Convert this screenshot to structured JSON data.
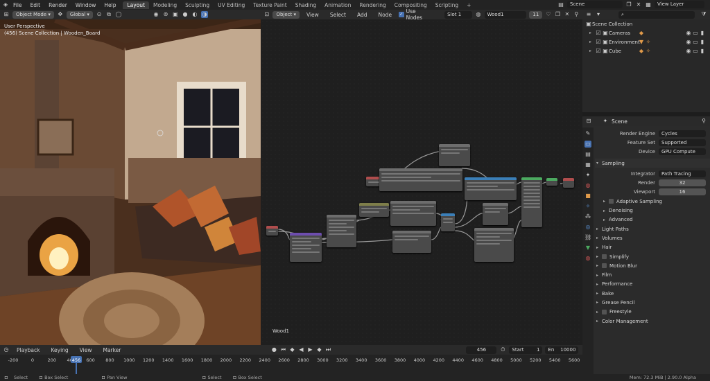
{
  "topbar": {
    "menu": [
      "File",
      "Edit",
      "Render",
      "Window",
      "Help"
    ],
    "tabs": [
      "Layout",
      "Modeling",
      "Sculpting",
      "UV Editing",
      "Texture Paint",
      "Shading",
      "Animation",
      "Rendering",
      "Compositing",
      "Scripting"
    ],
    "active_tab": "Layout",
    "scene": "Scene",
    "view_layer": "View Layer"
  },
  "viewport_header": {
    "mode": "Object Mode",
    "orientation": "Global"
  },
  "viewport": {
    "perspective": "User Perspective",
    "collection": "(456) Scene Collection | Wooden_Board"
  },
  "node_header": {
    "object": "Object",
    "menu": [
      "View",
      "Select",
      "Add",
      "Node"
    ],
    "use_nodes": "Use Nodes",
    "slot": "Slot 1",
    "material": "Wood1",
    "users": "11"
  },
  "node_editor": {
    "material_label": "Wood1"
  },
  "outliner": {
    "root": "Scene Collection",
    "items": [
      "Cameras",
      "Environment",
      "Cube"
    ]
  },
  "properties": {
    "context": "Scene",
    "render_engine": {
      "label": "Render Engine",
      "value": "Cycles"
    },
    "feature_set": {
      "label": "Feature Set",
      "value": "Supported"
    },
    "device": {
      "label": "Device",
      "value": "GPU Compute"
    },
    "sampling": "Sampling",
    "integrator": {
      "label": "Integrator",
      "value": "Path Tracing"
    },
    "render": {
      "label": "Render",
      "value": "32"
    },
    "viewport": {
      "label": "Viewport",
      "value": "16"
    },
    "sub_sections": [
      "Adaptive Sampling",
      "Denoising",
      "Advanced"
    ],
    "sections": [
      "Light Paths",
      "Volumes",
      "Hair",
      "Simplify",
      "Motion Blur",
      "Film",
      "Performance",
      "Bake",
      "Grease Pencil",
      "Freestyle",
      "Color Management"
    ]
  },
  "timeline": {
    "menu": [
      "Playback",
      "Keying",
      "View",
      "Marker"
    ],
    "current_frame": "456",
    "start_label": "Start",
    "start": "1",
    "end_label": "En",
    "end": "10000",
    "ticks": [
      "-200",
      "0",
      "200",
      "400",
      "456",
      "600",
      "800",
      "1000",
      "1200",
      "1400",
      "1600",
      "1800",
      "2000",
      "2200",
      "2400",
      "2600",
      "2800",
      "3000",
      "3200",
      "3400",
      "3600",
      "3800",
      "4000",
      "4200",
      "4400",
      "4600",
      "4800",
      "5000",
      "5200",
      "5400",
      "5600"
    ]
  },
  "statusbar": {
    "left": [
      "Select",
      "Box Select",
      "Pan View",
      "Select",
      "Box Select"
    ],
    "right": "Mem: 72.3 MiB | 2.90.0 Alpha"
  },
  "colors": {
    "accent": "#4772b3",
    "header": "#2a2a2a",
    "panel": "#2b2b2b"
  }
}
